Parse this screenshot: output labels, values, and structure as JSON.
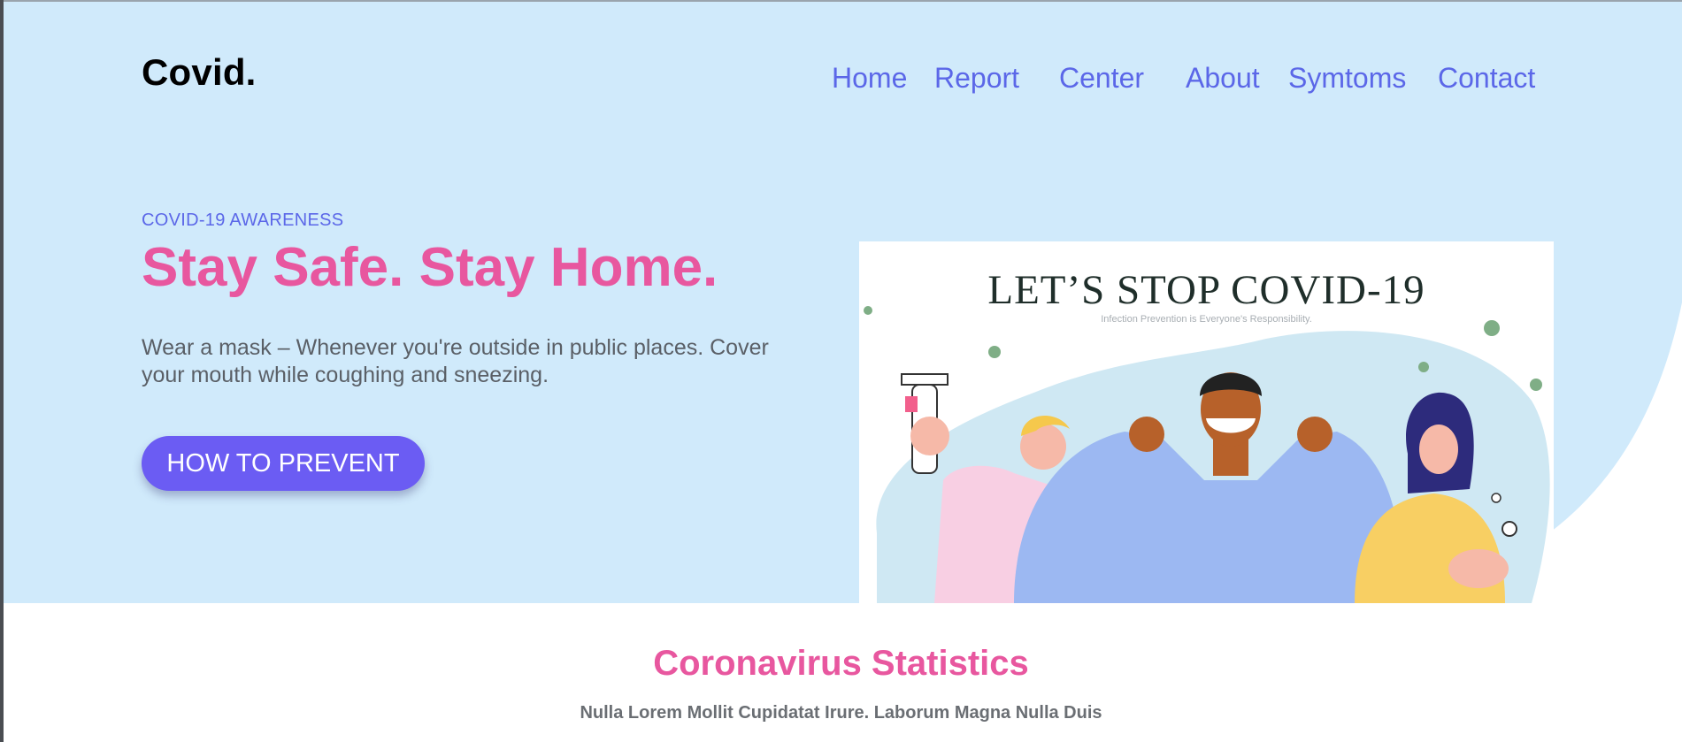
{
  "header": {
    "logo": "Covid.",
    "nav": [
      {
        "label": "Home"
      },
      {
        "label": "Report"
      },
      {
        "label": "Center"
      },
      {
        "label": "About"
      },
      {
        "label": "Symtoms"
      },
      {
        "label": "Contact"
      }
    ]
  },
  "hero": {
    "eyebrow": "COVID-19 AWARENESS",
    "headline": "Stay Safe. Stay Home.",
    "description": "Wear a mask – Whenever you're outside in public places. Cover your mouth while coughing and sneezing.",
    "cta_label": "HOW TO PREVENT",
    "poster": {
      "title": "LET’S STOP COVID-19",
      "subtitle": "Infection Prevention is Everyone's Responsibility."
    }
  },
  "stats": {
    "title": "Coronavirus Statistics",
    "subtitle": "Nulla Lorem Mollit Cupidatat Irure. Laborum Magna Nulla Duis"
  },
  "colors": {
    "hero_bg": "#d0eafb",
    "accent_pink": "#e8579f",
    "accent_blue": "#5b67e8",
    "button": "#6b5cf3"
  }
}
